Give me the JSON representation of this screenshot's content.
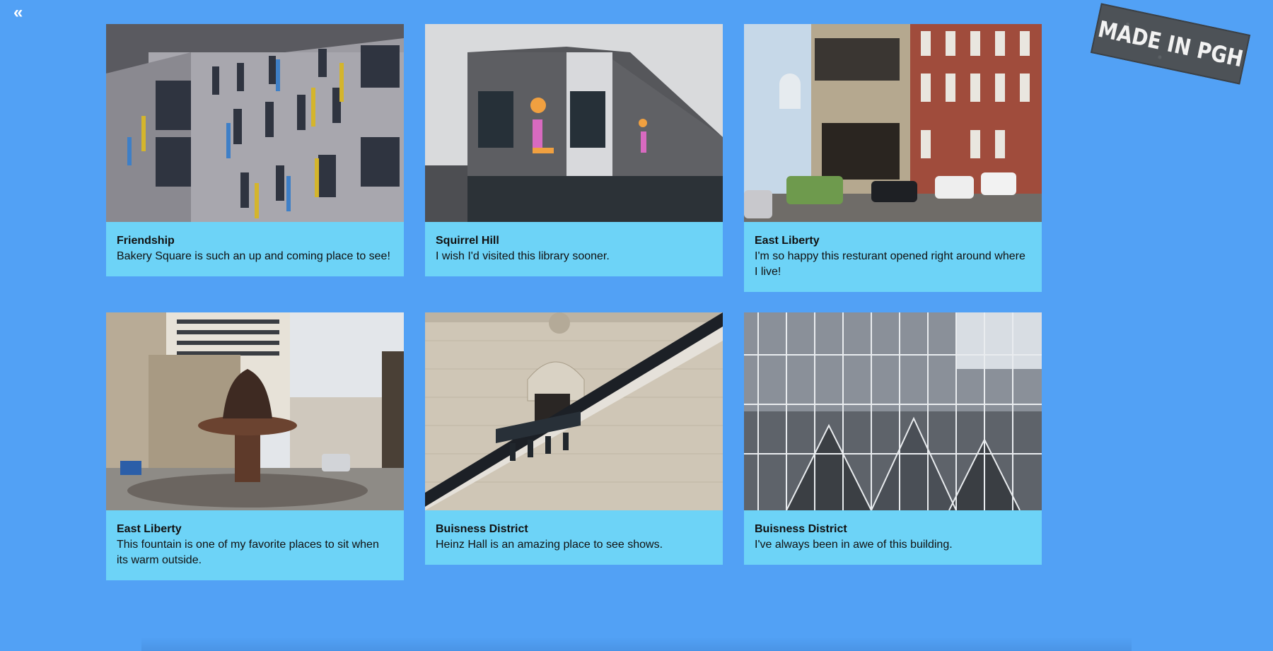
{
  "nav": {
    "back_label": "«"
  },
  "stamp": {
    "text": "MADE IN PGH"
  },
  "cards": [
    {
      "title": "Friendship",
      "text": "Bakery Square is such an up and coming place to see!"
    },
    {
      "title": "Squirrel Hill",
      "text": "I wish I'd visited this library sooner."
    },
    {
      "title": "East Liberty",
      "text": "I'm so happy this resturant opened right around where I live!"
    },
    {
      "title": "East Liberty",
      "text": "This fountain is one of my favorite places to sit when its warm outside."
    },
    {
      "title": "Buisness District",
      "text": "Heinz Hall is an amazing place to see shows."
    },
    {
      "title": "Buisness District",
      "text": "I've always been in awe of this building."
    }
  ],
  "colors": {
    "background": "#52a1f5",
    "card": "#6dd3f7"
  }
}
